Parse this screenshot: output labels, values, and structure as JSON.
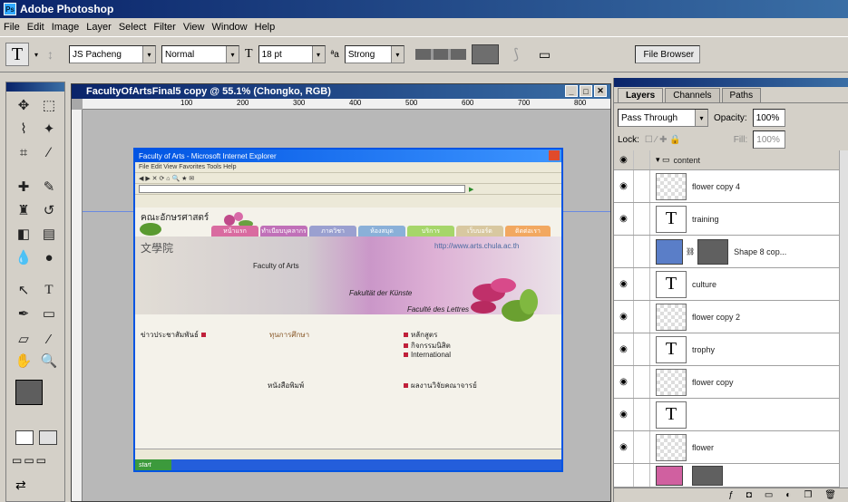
{
  "app": {
    "title": "Adobe Photoshop",
    "logo": "Ps"
  },
  "menu": [
    "File",
    "Edit",
    "Image",
    "Layer",
    "Select",
    "Filter",
    "View",
    "Window",
    "Help"
  ],
  "options": {
    "tool_glyph": "T",
    "font_family": "JS Pacheng",
    "font_style": "Normal",
    "font_size": "18 pt",
    "antialias": "Strong",
    "file_browser": "File Browser",
    "text_color": "#6e6e6e"
  },
  "document": {
    "title": "FacultyOfArtsFinal5 copy @ 55.1% (Chongko, RGB)",
    "ruler_ticks": [
      "100",
      "200",
      "300",
      "400",
      "500",
      "600",
      "700",
      "800"
    ],
    "browser": {
      "title": "Faculty of Arts - Microsoft Internet Explorer",
      "menu": "File Edit View Favorites Tools Help",
      "site_title": "คณะอักษรศาสตร์",
      "url": "http://www.arts.chula.ac.th",
      "tabs": [
        {
          "label": "หน้าแรก",
          "color": "#d96ba0"
        },
        {
          "label": "ทำเนียบบุคลากร",
          "color": "#c070b8"
        },
        {
          "label": "ภาควิชา",
          "color": "#9aa0d0"
        },
        {
          "label": "ห้องสมุด",
          "color": "#8ab0d8"
        },
        {
          "label": "บริการ",
          "color": "#a6d66a"
        },
        {
          "label": "เว็บบอร์ด",
          "color": "#d8c8a0"
        },
        {
          "label": "ติดต่อเรา",
          "color": "#f2a860"
        }
      ],
      "chinese_label": "文學院",
      "faculty_en": "Faculty of Arts",
      "faculty_fr": "Faculté des Lettres",
      "faculty_de": "Fakultät der Künste",
      "links_left": [
        "ข่าวประชาสัมพันธ์"
      ],
      "links_right": [
        "หลักสูตร",
        "กิจกรรมนิสิต",
        "International"
      ],
      "link_middle": "ทุนการศึกษา",
      "link_bottom_mid": "หนังสือพิมพ์",
      "link_bottom_right": "ผลงานวิจัยคณาจารย์"
    }
  },
  "layers_panel": {
    "tabs": [
      "Layers",
      "Channels",
      "Paths"
    ],
    "blend_mode": "Pass Through",
    "opacity": "100%",
    "opacity_label": "Opacity:",
    "lock_label": "Lock:",
    "fill_label": "Fill:",
    "fill": "100%",
    "layers": [
      {
        "name": "content",
        "type": "group",
        "visible": true
      },
      {
        "name": "flower copy 4",
        "type": "raster",
        "visible": true
      },
      {
        "name": "training",
        "type": "text",
        "visible": true
      },
      {
        "name": "Shape 8 cop...",
        "type": "shape",
        "visible": false
      },
      {
        "name": "culture",
        "type": "text",
        "visible": true
      },
      {
        "name": "flower copy 2",
        "type": "raster",
        "visible": true
      },
      {
        "name": "trophy",
        "type": "text",
        "visible": true
      },
      {
        "name": "flower copy",
        "type": "raster",
        "visible": true
      },
      {
        "name": "",
        "type": "text",
        "visible": true
      },
      {
        "name": "flower",
        "type": "raster",
        "visible": true
      }
    ]
  },
  "tools": [
    "move-icon",
    "marquee-icon",
    "lasso-icon",
    "magic-wand-icon",
    "crop-icon",
    "slice-icon",
    "healing-brush-icon",
    "brush-icon",
    "clone-stamp-icon",
    "history-brush-icon",
    "eraser-icon",
    "gradient-icon",
    "blur-icon",
    "dodge-icon",
    "path-selection-icon",
    "type-icon",
    "pen-icon",
    "shape-icon",
    "notes-icon",
    "eyedropper-icon",
    "hand-icon",
    "zoom-icon"
  ],
  "colors": {
    "foreground": "#5e5e5e",
    "background": "#ffffff"
  }
}
